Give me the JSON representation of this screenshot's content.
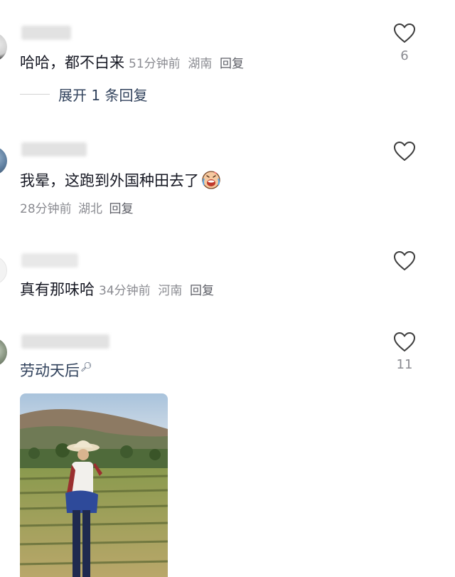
{
  "comments": [
    {
      "username": "·· ·",
      "text": "哈哈，都不白来",
      "time": "51分钟前",
      "location": "湖南",
      "reply_label": "回复",
      "likes": "6",
      "expand_label": "展开 1 条回复"
    },
    {
      "username": "ヨ·· ··",
      "text": "我晕，这跑到外国种田去了",
      "time": "28分钟前",
      "location": "湖北",
      "reply_label": "回复",
      "likes": ""
    },
    {
      "username": "C··· ··",
      "text": "真有那味哈",
      "time": "34分钟前",
      "location": "河南",
      "reply_label": "回复",
      "likes": ""
    },
    {
      "username": "·· ·· ··",
      "text": "劳动天后",
      "likes": "11"
    }
  ],
  "colors": {
    "text": "#161823",
    "meta": "#8a8b91",
    "link": "#31425c"
  }
}
